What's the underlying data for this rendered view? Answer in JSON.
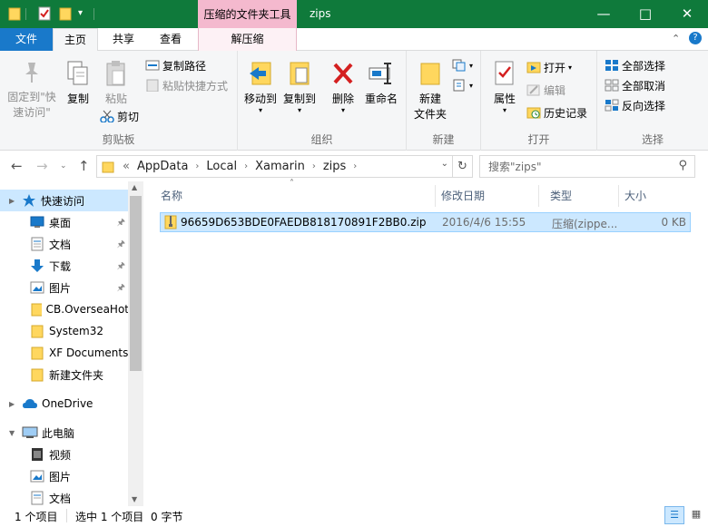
{
  "titlebar": {
    "context_tab_group": "压缩的文件夹工具",
    "window_title": "zips",
    "bg_color": "#0f7a3b"
  },
  "tabs": {
    "file": "文件",
    "home": "主页",
    "share": "共享",
    "view": "查看",
    "extract": "解压缩"
  },
  "ribbon": {
    "clipboard": {
      "label": "剪贴板",
      "pin_quick_access_line1": "固定到\"快",
      "pin_quick_access_line2": "速访问\"",
      "copy": "复制",
      "paste": "粘贴",
      "copy_path": "复制路径",
      "paste_shortcut": "粘贴快捷方式",
      "cut": "剪切"
    },
    "organize": {
      "label": "组织",
      "move_to": "移动到",
      "copy_to": "复制到",
      "delete": "删除",
      "rename": "重命名"
    },
    "new": {
      "label": "新建",
      "new_folder_line1": "新建",
      "new_folder_line2": "文件夹"
    },
    "open": {
      "label": "打开",
      "properties": "属性",
      "open": "打开",
      "edit": "编辑",
      "history": "历史记录"
    },
    "select": {
      "label": "选择",
      "select_all": "全部选择",
      "select_none": "全部取消",
      "invert_selection": "反向选择"
    }
  },
  "address": {
    "overflow": "«",
    "crumbs": [
      "AppData",
      "Local",
      "Xamarin",
      "zips"
    ],
    "search_placeholder": "搜索\"zips\""
  },
  "nav": {
    "items": [
      {
        "label": "快速访问",
        "icon": "star-icon"
      },
      {
        "label": "桌面",
        "icon": "desktop-icon"
      },
      {
        "label": "文档",
        "icon": "document-icon"
      },
      {
        "label": "下载",
        "icon": "download-icon"
      },
      {
        "label": "图片",
        "icon": "picture-icon"
      },
      {
        "label": "CB.OverseaHot",
        "icon": "folder-icon"
      },
      {
        "label": "System32",
        "icon": "folder-icon"
      },
      {
        "label": "XF Documents",
        "icon": "folder-icon"
      },
      {
        "label": "新建文件夹",
        "icon": "folder-icon"
      },
      {
        "label": "OneDrive",
        "icon": "cloud-icon"
      },
      {
        "label": "此电脑",
        "icon": "computer-icon"
      },
      {
        "label": "视频",
        "icon": "video-icon"
      },
      {
        "label": "图片",
        "icon": "picture-icon"
      },
      {
        "label": "文档",
        "icon": "document-icon"
      }
    ]
  },
  "list": {
    "columns": [
      "名称",
      "修改日期",
      "类型",
      "大小"
    ],
    "rows": [
      {
        "name": "96659D653BDE0FAEDB818170891F2BB0.zip",
        "modified": "2016/4/6 15:55",
        "type": "压缩(zippe...",
        "size": "0 KB"
      }
    ]
  },
  "status": {
    "item_count": "1 个项目",
    "selected": "选中 1 个项目",
    "size": "0 字节"
  }
}
